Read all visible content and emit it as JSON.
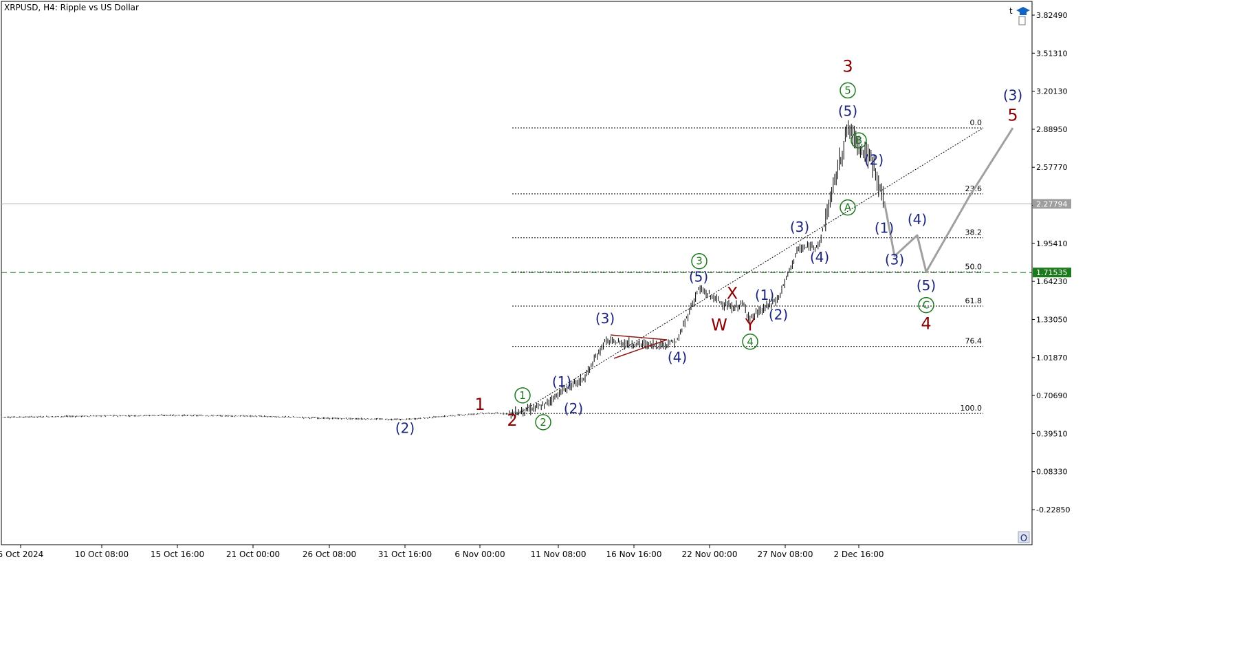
{
  "header": {
    "symbol": "XRPUSD, H4:",
    "description": "Ripple vs US Dollar",
    "corner_letter": "t",
    "bottom_button": "O"
  },
  "colors": {
    "blue": "#1a237e",
    "green": "#1b7a1b",
    "darkred": "#8b0000",
    "gray": "#a0a0a0",
    "fib_line": "#000000",
    "green_dash": "#1b7a1b",
    "price_tag_gray": "#9e9e9e",
    "price_tag_green": "#1b7a1b"
  },
  "chart_data": {
    "type": "candlestick",
    "symbol": "XRPUSD",
    "timeframe": "H4",
    "y_ticks": [
      "3.82490",
      "3.51310",
      "3.20130",
      "2.88950",
      "2.57770",
      "2.26590",
      "1.95410",
      "1.64230",
      "1.33050",
      "1.01870",
      "0.70690",
      "0.39510",
      "0.08330",
      "-0.22850"
    ],
    "y_range": [
      -0.4,
      3.95
    ],
    "x_ticks": [
      "5 Oct 2024",
      "10 Oct 08:00",
      "15 Oct 16:00",
      "21 Oct 00:00",
      "26 Oct 08:00",
      "31 Oct 16:00",
      "6 Nov 00:00",
      "11 Nov 08:00",
      "16 Nov 16:00",
      "22 Nov 00:00",
      "27 Nov 08:00",
      "2 Dec 16:00"
    ],
    "current_price": "2.27794",
    "horizontal_level": "1.71535",
    "fib_levels": [
      {
        "label": "0.0",
        "price": 2.9
      },
      {
        "label": "23.6",
        "price": 2.36
      },
      {
        "label": "38.2",
        "price": 2.0
      },
      {
        "label": "50.0",
        "price": 1.72
      },
      {
        "label": "61.8",
        "price": 1.44
      },
      {
        "label": "76.4",
        "price": 1.11
      },
      {
        "label": "100.0",
        "price": 0.56
      }
    ],
    "series": [
      {
        "points": [
          [
            "5 Oct 2024",
            0.53
          ],
          [
            "10 Oct 08:00",
            0.54
          ],
          [
            "15 Oct 16:00",
            0.545
          ],
          [
            "21 Oct 00:00",
            0.538
          ],
          [
            "26 Oct 08:00",
            0.52
          ],
          [
            "31 Oct 16:00",
            0.51
          ],
          [
            "6 Nov 00:00",
            0.56
          ],
          [
            "8 Nov",
            0.56
          ],
          [
            "10 Nov",
            0.62
          ],
          [
            "11 Nov 08:00",
            0.72
          ],
          [
            "13 Nov",
            0.85
          ],
          [
            "15 Nov",
            1.15
          ],
          [
            "16 Nov 16:00",
            1.13
          ],
          [
            "19 Nov",
            1.12
          ],
          [
            "20 Nov",
            1.15
          ],
          [
            "22 Nov 00:00",
            1.58
          ],
          [
            "24 Nov",
            1.42
          ],
          [
            "25 Nov",
            1.46
          ],
          [
            "26 Nov",
            1.34
          ],
          [
            "27 Nov 08:00",
            1.5
          ],
          [
            "28 Nov",
            1.9
          ],
          [
            "30 Nov",
            1.95
          ],
          [
            "1 Dec",
            2.9
          ],
          [
            "2 Dec 16:00",
            2.6
          ],
          [
            "3 Dec",
            2.28
          ]
        ]
      }
    ],
    "forecast_path": [
      [
        "3 Dec",
        2.3
      ],
      [
        "4 Dec",
        1.85
      ],
      [
        "5 Dec",
        2.02
      ],
      [
        "6 Dec",
        1.72
      ],
      [
        "7 Dec",
        2.34
      ],
      [
        "9 Dec",
        2.9
      ]
    ],
    "wave_labels": [
      {
        "text": "(2)",
        "color": "blue",
        "x": "31 Oct 16:00",
        "y": 0.4
      },
      {
        "text": "1",
        "color": "darkred",
        "x": "6 Nov 00:00",
        "y": 0.59
      },
      {
        "text": "2",
        "color": "darkred",
        "x": "8 Nov",
        "y": 0.46
      },
      {
        "text": "1",
        "color": "green",
        "circled": true,
        "x": "9 Nov",
        "y": 0.68
      },
      {
        "text": "2",
        "color": "green",
        "circled": true,
        "x": "10 Nov",
        "y": 0.46
      },
      {
        "text": "(1)",
        "color": "blue",
        "x": "11 Nov",
        "y": 0.78
      },
      {
        "text": "(2)",
        "color": "blue",
        "x": "12 Nov",
        "y": 0.56
      },
      {
        "text": "(3)",
        "color": "blue",
        "x": "15 Nov",
        "y": 1.3
      },
      {
        "text": "(4)",
        "color": "blue",
        "x": "20 Nov",
        "y": 0.98
      },
      {
        "text": "3",
        "color": "green",
        "circled": true,
        "x": "22 Nov",
        "y": 1.78
      },
      {
        "text": "(5)",
        "color": "blue",
        "x": "22 Nov 00:00",
        "y": 1.64
      },
      {
        "text": "X",
        "color": "darkred",
        "x": "24 Nov",
        "y": 1.5
      },
      {
        "text": "W",
        "color": "darkred",
        "x": "23 Nov",
        "y": 1.24
      },
      {
        "text": "Y",
        "color": "darkred",
        "x": "26 Nov",
        "y": 1.24
      },
      {
        "text": "4",
        "color": "green",
        "circled": true,
        "x": "26 Nov",
        "y": 1.12
      },
      {
        "text": "(1)",
        "color": "blue",
        "x": "27 Nov",
        "y": 1.49
      },
      {
        "text": "(2)",
        "color": "blue",
        "x": "27 Nov 08:00",
        "y": 1.33
      },
      {
        "text": "(3)",
        "color": "blue",
        "x": "29 Nov",
        "y": 2.05
      },
      {
        "text": "(4)",
        "color": "blue",
        "x": "30 Nov",
        "y": 1.8
      },
      {
        "text": "A",
        "color": "green",
        "circled": true,
        "x": "1 Dec",
        "y": 2.22
      },
      {
        "text": "5",
        "color": "green",
        "circled": true,
        "x": "1 Dec",
        "y": 3.18
      },
      {
        "text": "(5)",
        "color": "blue",
        "x": "1 Dec",
        "y": 3.0
      },
      {
        "text": "3",
        "color": "darkred",
        "x": "1 Dec",
        "y": 3.36
      },
      {
        "text": "B",
        "color": "green",
        "circled": true,
        "x": "2 Dec",
        "y": 2.77
      },
      {
        "text": "(2)",
        "color": "blue",
        "x": "2 Dec 16:00",
        "y": 2.6
      },
      {
        "text": "(1)",
        "color": "blue",
        "x": "3 Dec",
        "y": 2.04
      },
      {
        "text": "(3)",
        "color": "blue",
        "x": "4 Dec",
        "y": 1.78
      },
      {
        "text": "(4)",
        "color": "blue",
        "x": "5 Dec",
        "y": 2.11
      },
      {
        "text": "(5)",
        "color": "blue",
        "x": "6 Dec",
        "y": 1.57
      },
      {
        "text": "C",
        "color": "green",
        "circled": true,
        "x": "6 Dec",
        "y": 1.42
      },
      {
        "text": "4",
        "color": "darkred",
        "x": "6 Dec",
        "y": 1.25
      },
      {
        "text": "(3)",
        "color": "blue",
        "x": "9 Dec",
        "y": 3.13
      },
      {
        "text": "5",
        "color": "darkred",
        "x": "9 Dec",
        "y": 2.96
      }
    ],
    "grid": false,
    "legend": "none"
  }
}
